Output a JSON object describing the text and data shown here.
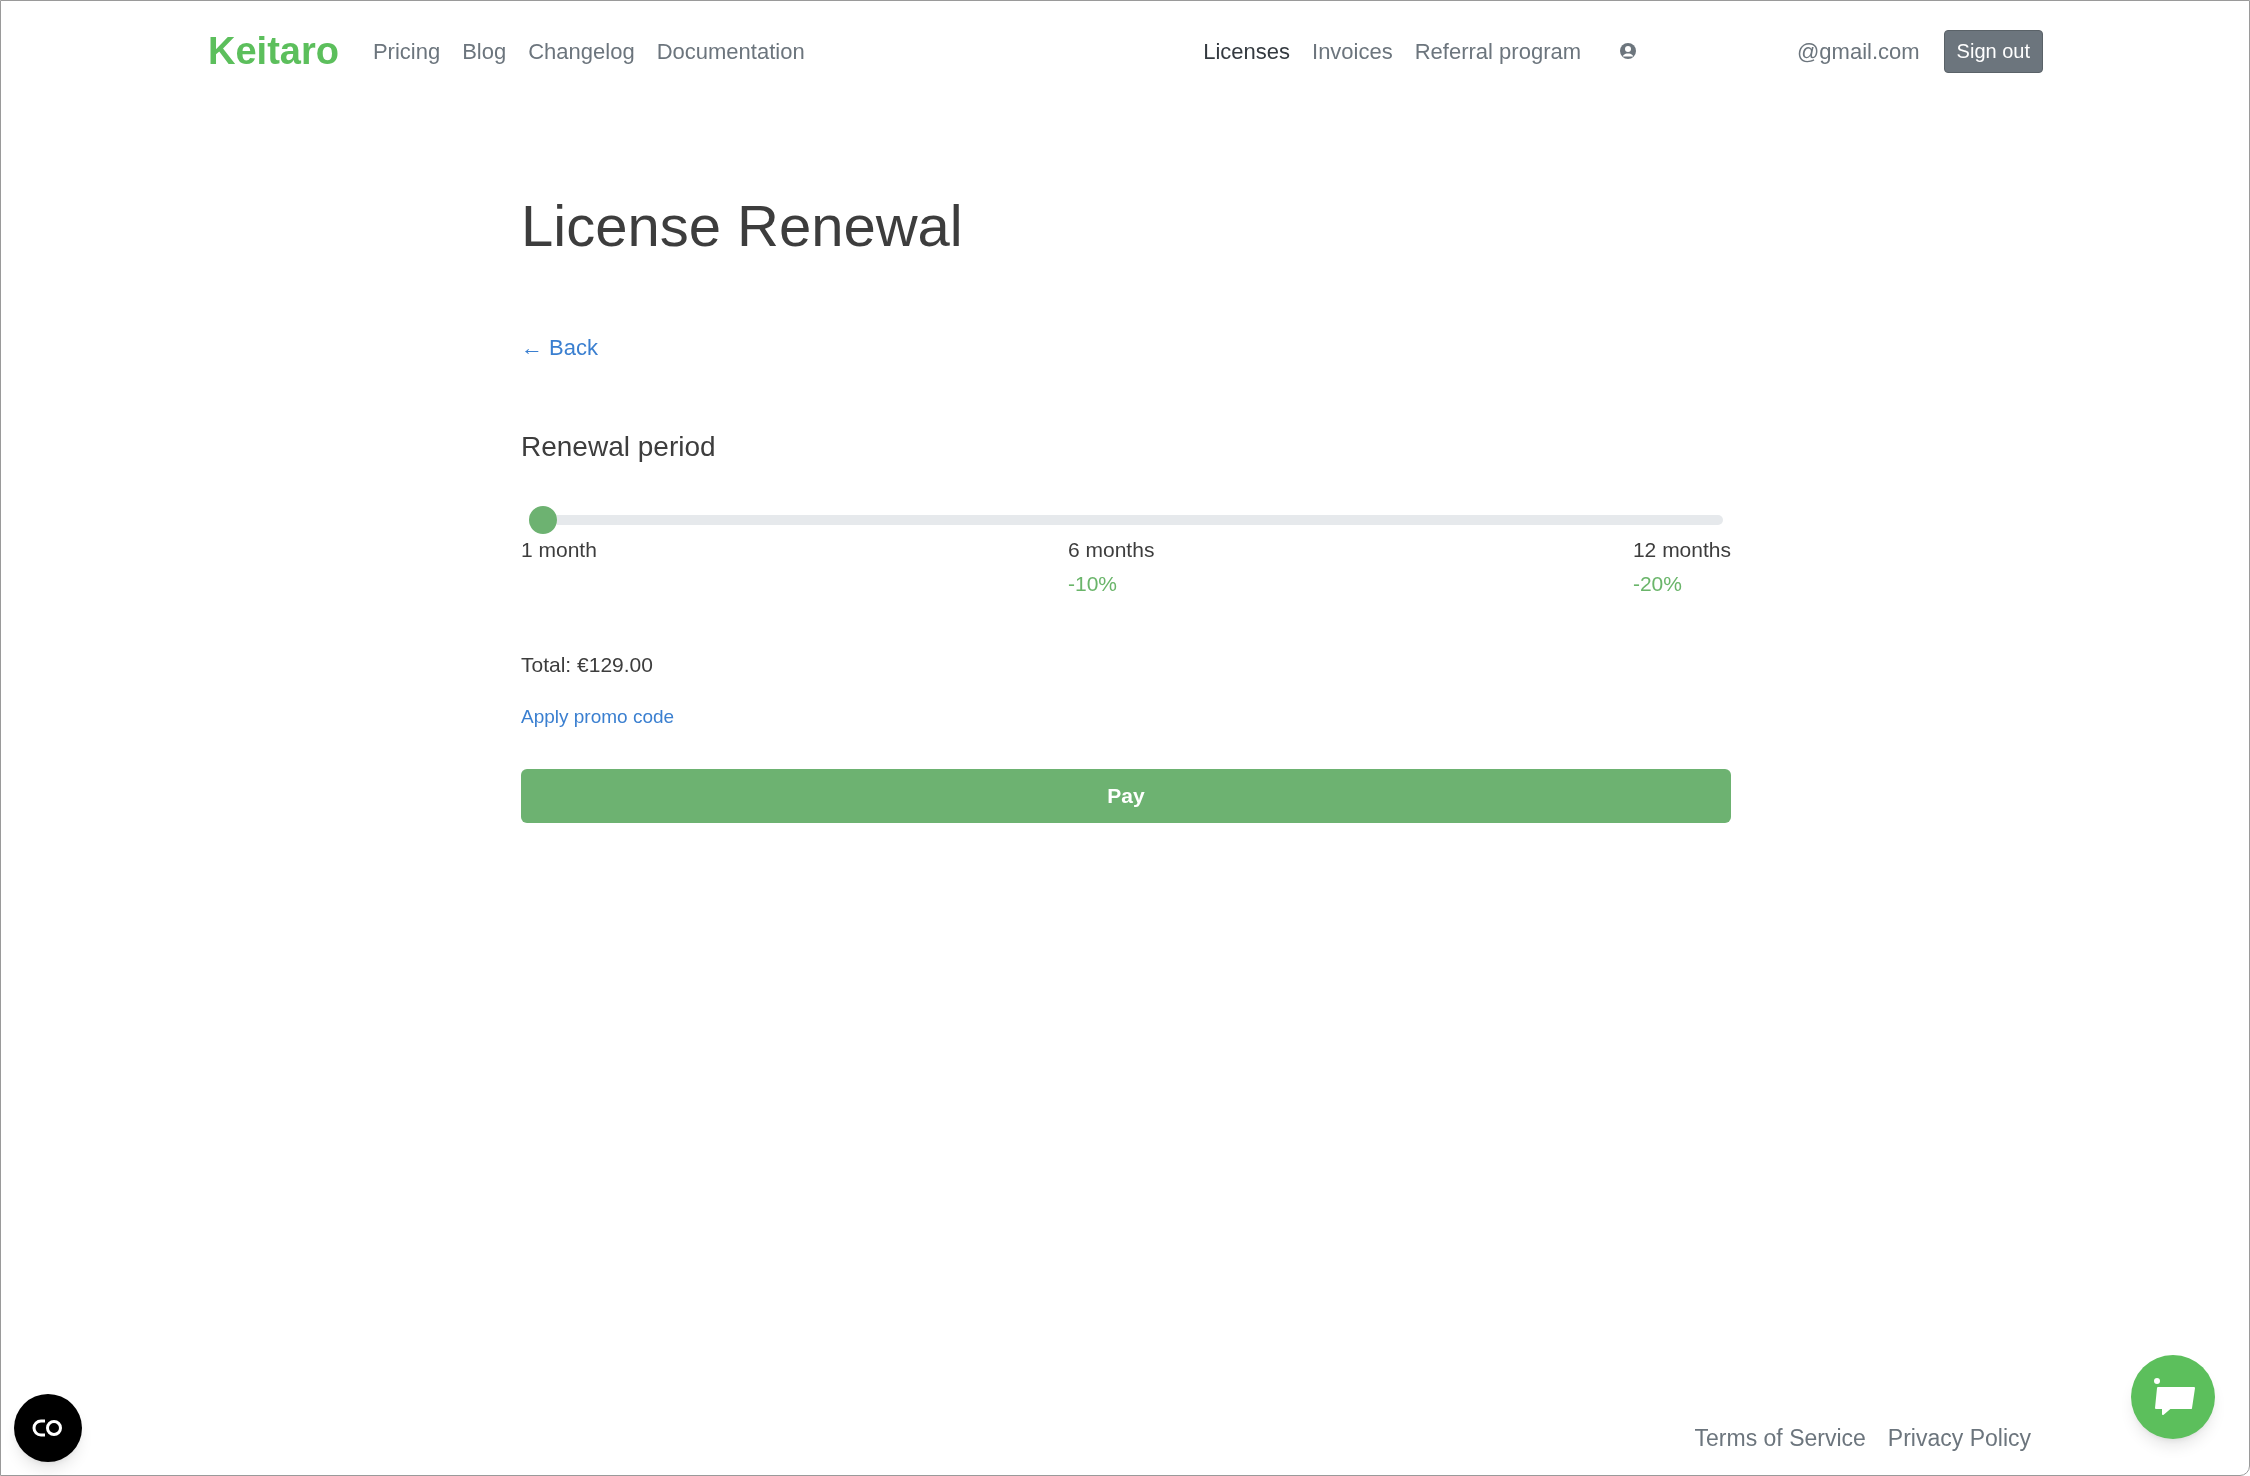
{
  "header": {
    "logo": "Keitaro",
    "nav_left": [
      {
        "label": "Pricing"
      },
      {
        "label": "Blog"
      },
      {
        "label": "Changelog"
      },
      {
        "label": "Documentation"
      }
    ],
    "nav_right": [
      {
        "label": "Licenses",
        "selected": true
      },
      {
        "label": "Invoices",
        "selected": false
      },
      {
        "label": "Referral program",
        "selected": false
      }
    ],
    "email": "@gmail.com",
    "sign_out": "Sign out"
  },
  "page": {
    "title": "License Renewal",
    "back_link": "← Back",
    "period_label": "Renewal period",
    "slider": {
      "level": 0,
      "ticks": [
        {
          "label": "1 month"
        },
        {
          "label": "6 months",
          "discount": "-10%"
        },
        {
          "label": "12 months",
          "discount": "-20%"
        }
      ]
    },
    "total": "Total: €129.00",
    "promo_link": "Apply promo code",
    "pay_button": "Pay"
  },
  "footer": {
    "links": [
      "Terms of Service",
      "Privacy Policy"
    ]
  }
}
